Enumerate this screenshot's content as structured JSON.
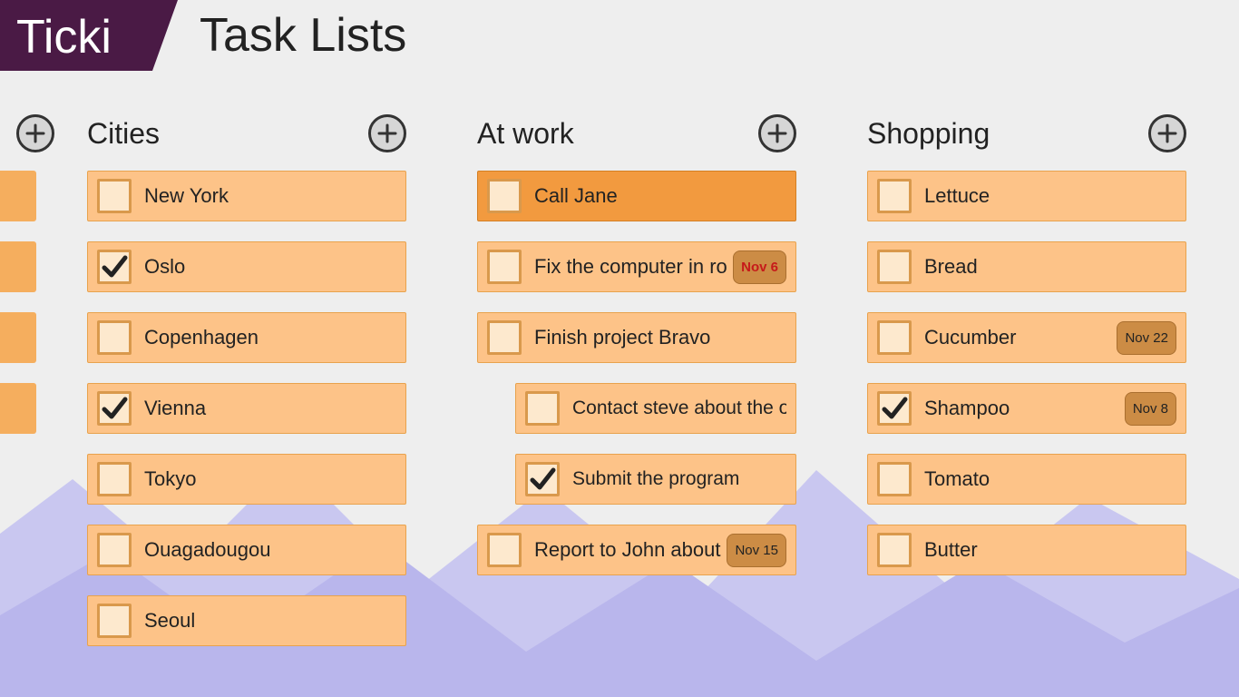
{
  "app": {
    "brand": "Ticki",
    "page_title": "Task Lists"
  },
  "edge_items": 4,
  "lists": [
    {
      "id": "cities",
      "title": "Cities",
      "tasks": [
        {
          "label": "New York",
          "checked": false,
          "date": null,
          "overdue": false,
          "sub": false,
          "selected": false
        },
        {
          "label": "Oslo",
          "checked": true,
          "date": null,
          "overdue": false,
          "sub": false,
          "selected": false
        },
        {
          "label": "Copenhagen",
          "checked": false,
          "date": null,
          "overdue": false,
          "sub": false,
          "selected": false
        },
        {
          "label": "Vienna",
          "checked": true,
          "date": null,
          "overdue": false,
          "sub": false,
          "selected": false
        },
        {
          "label": "Tokyo",
          "checked": false,
          "date": null,
          "overdue": false,
          "sub": false,
          "selected": false
        },
        {
          "label": "Ouagadougou",
          "checked": false,
          "date": null,
          "overdue": false,
          "sub": false,
          "selected": false
        },
        {
          "label": "Seoul",
          "checked": false,
          "date": null,
          "overdue": false,
          "sub": false,
          "selected": false
        }
      ]
    },
    {
      "id": "at-work",
      "title": "At work",
      "tasks": [
        {
          "label": "Call Jane",
          "checked": false,
          "date": null,
          "overdue": false,
          "sub": false,
          "selected": true
        },
        {
          "label": "Fix the computer in roo",
          "checked": false,
          "date": "Nov 6",
          "overdue": true,
          "sub": false,
          "selected": false
        },
        {
          "label": "Finish project Bravo",
          "checked": false,
          "date": null,
          "overdue": false,
          "sub": false,
          "selected": false
        },
        {
          "label": "Contact steve about the off",
          "checked": false,
          "date": null,
          "overdue": false,
          "sub": true,
          "selected": false
        },
        {
          "label": "Submit the program",
          "checked": true,
          "date": null,
          "overdue": false,
          "sub": true,
          "selected": false
        },
        {
          "label": "Report to John about th",
          "checked": false,
          "date": "Nov 15",
          "overdue": false,
          "sub": false,
          "selected": false
        }
      ]
    },
    {
      "id": "shopping",
      "title": "Shopping",
      "tasks": [
        {
          "label": "Lettuce",
          "checked": false,
          "date": null,
          "overdue": false,
          "sub": false,
          "selected": false
        },
        {
          "label": "Bread",
          "checked": false,
          "date": null,
          "overdue": false,
          "sub": false,
          "selected": false
        },
        {
          "label": "Cucumber",
          "checked": false,
          "date": "Nov 22",
          "overdue": false,
          "sub": false,
          "selected": false
        },
        {
          "label": "Shampoo",
          "checked": true,
          "date": "Nov 8",
          "overdue": false,
          "sub": false,
          "selected": false
        },
        {
          "label": "Tomato",
          "checked": false,
          "date": null,
          "overdue": false,
          "sub": false,
          "selected": false
        },
        {
          "label": "Butter",
          "checked": false,
          "date": null,
          "overdue": false,
          "sub": false,
          "selected": false
        }
      ]
    }
  ]
}
